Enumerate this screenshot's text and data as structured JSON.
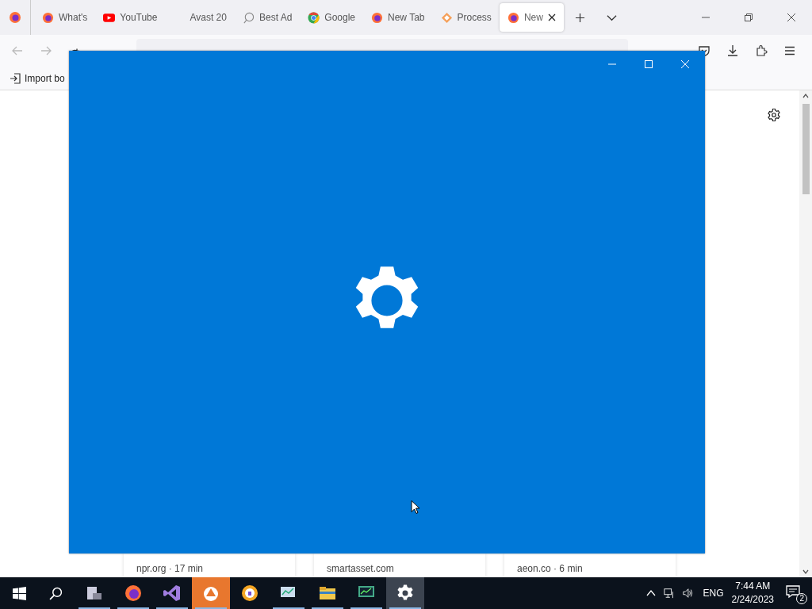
{
  "tabs": [
    {
      "label": "What's",
      "selected": false
    },
    {
      "label": "YouTube",
      "selected": false
    },
    {
      "label": "Avast 20",
      "selected": false
    },
    {
      "label": "Best Ad",
      "selected": false
    },
    {
      "label": "Google",
      "selected": false
    },
    {
      "label": "New Tab",
      "selected": false
    },
    {
      "label": "Process",
      "selected": false
    },
    {
      "label": "New",
      "selected": true
    }
  ],
  "bookmarks": [
    {
      "label": "Import bo"
    }
  ],
  "cards": [
    {
      "source": "npr.org · 17 min"
    },
    {
      "source": "smartasset.com"
    },
    {
      "source": "aeon.co · 6 min"
    }
  ],
  "dialog": {
    "kind": "settings-splash"
  },
  "taskbar": {
    "apps": [
      {
        "running": true,
        "selected": false
      },
      {
        "running": true,
        "selected": false
      },
      {
        "running": true,
        "selected": false
      },
      {
        "running": true,
        "selected": false
      },
      {
        "running": false,
        "selected": false
      },
      {
        "running": true,
        "selected": false
      },
      {
        "running": true,
        "selected": false
      },
      {
        "running": true,
        "selected": false
      },
      {
        "running": true,
        "selected": true
      }
    ],
    "tray": {
      "language": "ENG",
      "time": "7:44 AM",
      "date": "2/24/2023",
      "notifications": "2"
    }
  }
}
